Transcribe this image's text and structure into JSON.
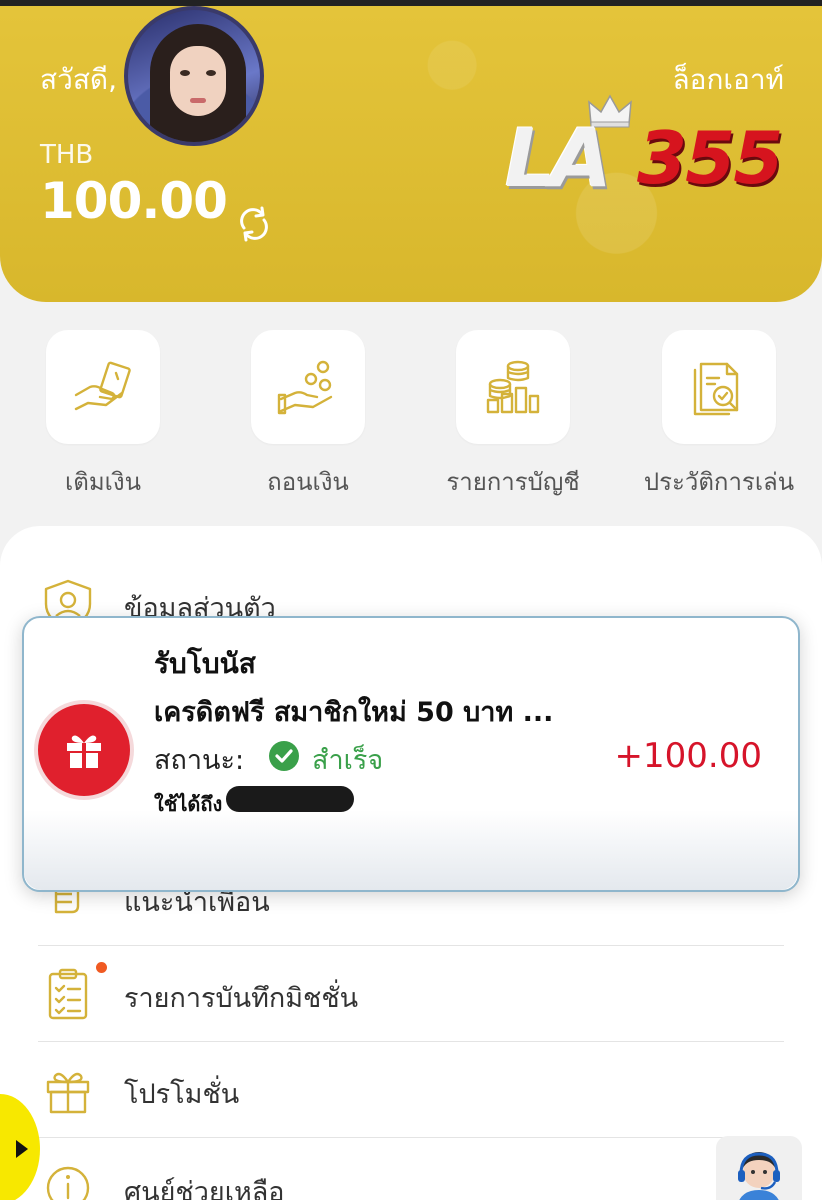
{
  "header": {
    "greeting": "สวัสดี,",
    "logout_label": "ล็อกเอาท์",
    "currency": "THB",
    "balance": "100.00",
    "logo_la": "LA",
    "logo_num": "355"
  },
  "actions": [
    {
      "label": "เติมเงิน",
      "icon": "deposit-hand-icon"
    },
    {
      "label": "ถอนเงิน",
      "icon": "withdraw-coins-icon"
    },
    {
      "label": "รายการบัญชี",
      "icon": "account-statement-icon"
    },
    {
      "label": "ประวัติการเล่น",
      "icon": "play-history-icon"
    }
  ],
  "menu": {
    "items": [
      {
        "label": "ข้อมูลส่วนตัว",
        "icon": "profile-shield-icon"
      },
      {
        "label": "แนะนำเพื่อน",
        "icon": "refer-friend-icon"
      },
      {
        "label": "รายการบันทึกมิชชั่น",
        "icon": "mission-clipboard-icon"
      },
      {
        "label": "โปรโมชั่น",
        "icon": "gift-icon"
      },
      {
        "label": "ศูนย์ช่วยเหลือ",
        "icon": "info-icon"
      }
    ]
  },
  "popup": {
    "title": "รับโบนัส",
    "subtitle": "เครดิตฟรี สมาชิกใหม่ 50 บาท ...",
    "status_label": "สถานะ:",
    "status_value": "สำเร็จ",
    "amount": "+100.00",
    "expiry_label": "ใช้ได้ถึง"
  },
  "colors": {
    "header_yellow": "#e0bf35",
    "accent_gold": "#d4b23a",
    "amount_red": "#d6142a",
    "success_green": "#3aa04a"
  }
}
